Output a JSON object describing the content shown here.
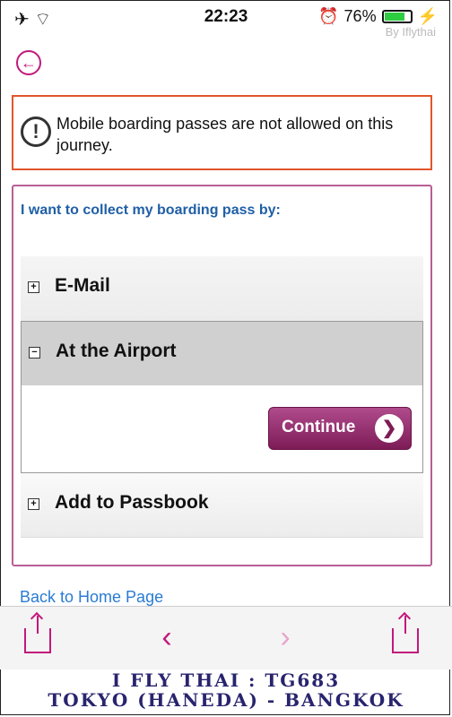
{
  "status_bar": {
    "left_icons": "✈ ⌔",
    "time": "22:23",
    "alarm_icon": "alarm-icon",
    "battery_percent": "76%",
    "battery_level": 0.76,
    "watermark": "By Iflythai"
  },
  "warning": {
    "icon": "warning-icon",
    "text": "Mobile boarding passes are not allowed on this journey."
  },
  "panel": {
    "heading": "I want to collect my boarding pass by:",
    "options": [
      {
        "label": "E-Mail",
        "state": "+"
      },
      {
        "label": "At the Airport",
        "state": "−"
      },
      {
        "label": "Add to Passbook",
        "state": "+"
      }
    ],
    "continue_label": "Continue",
    "continue_arrow": "❯"
  },
  "back_home": "Back to Home Page",
  "toolbar": {
    "back": "‹",
    "forward": "›"
  },
  "caption": {
    "line1": "I FLY THAI : TG683",
    "line2": "TOKYO (HANEDA) - BANGKOK"
  },
  "colors": {
    "accent": "#c2197b",
    "warning_border": "#e2562b",
    "panel_border": "#b85e96",
    "link": "#2a7bd4",
    "caption": "#28246e"
  }
}
